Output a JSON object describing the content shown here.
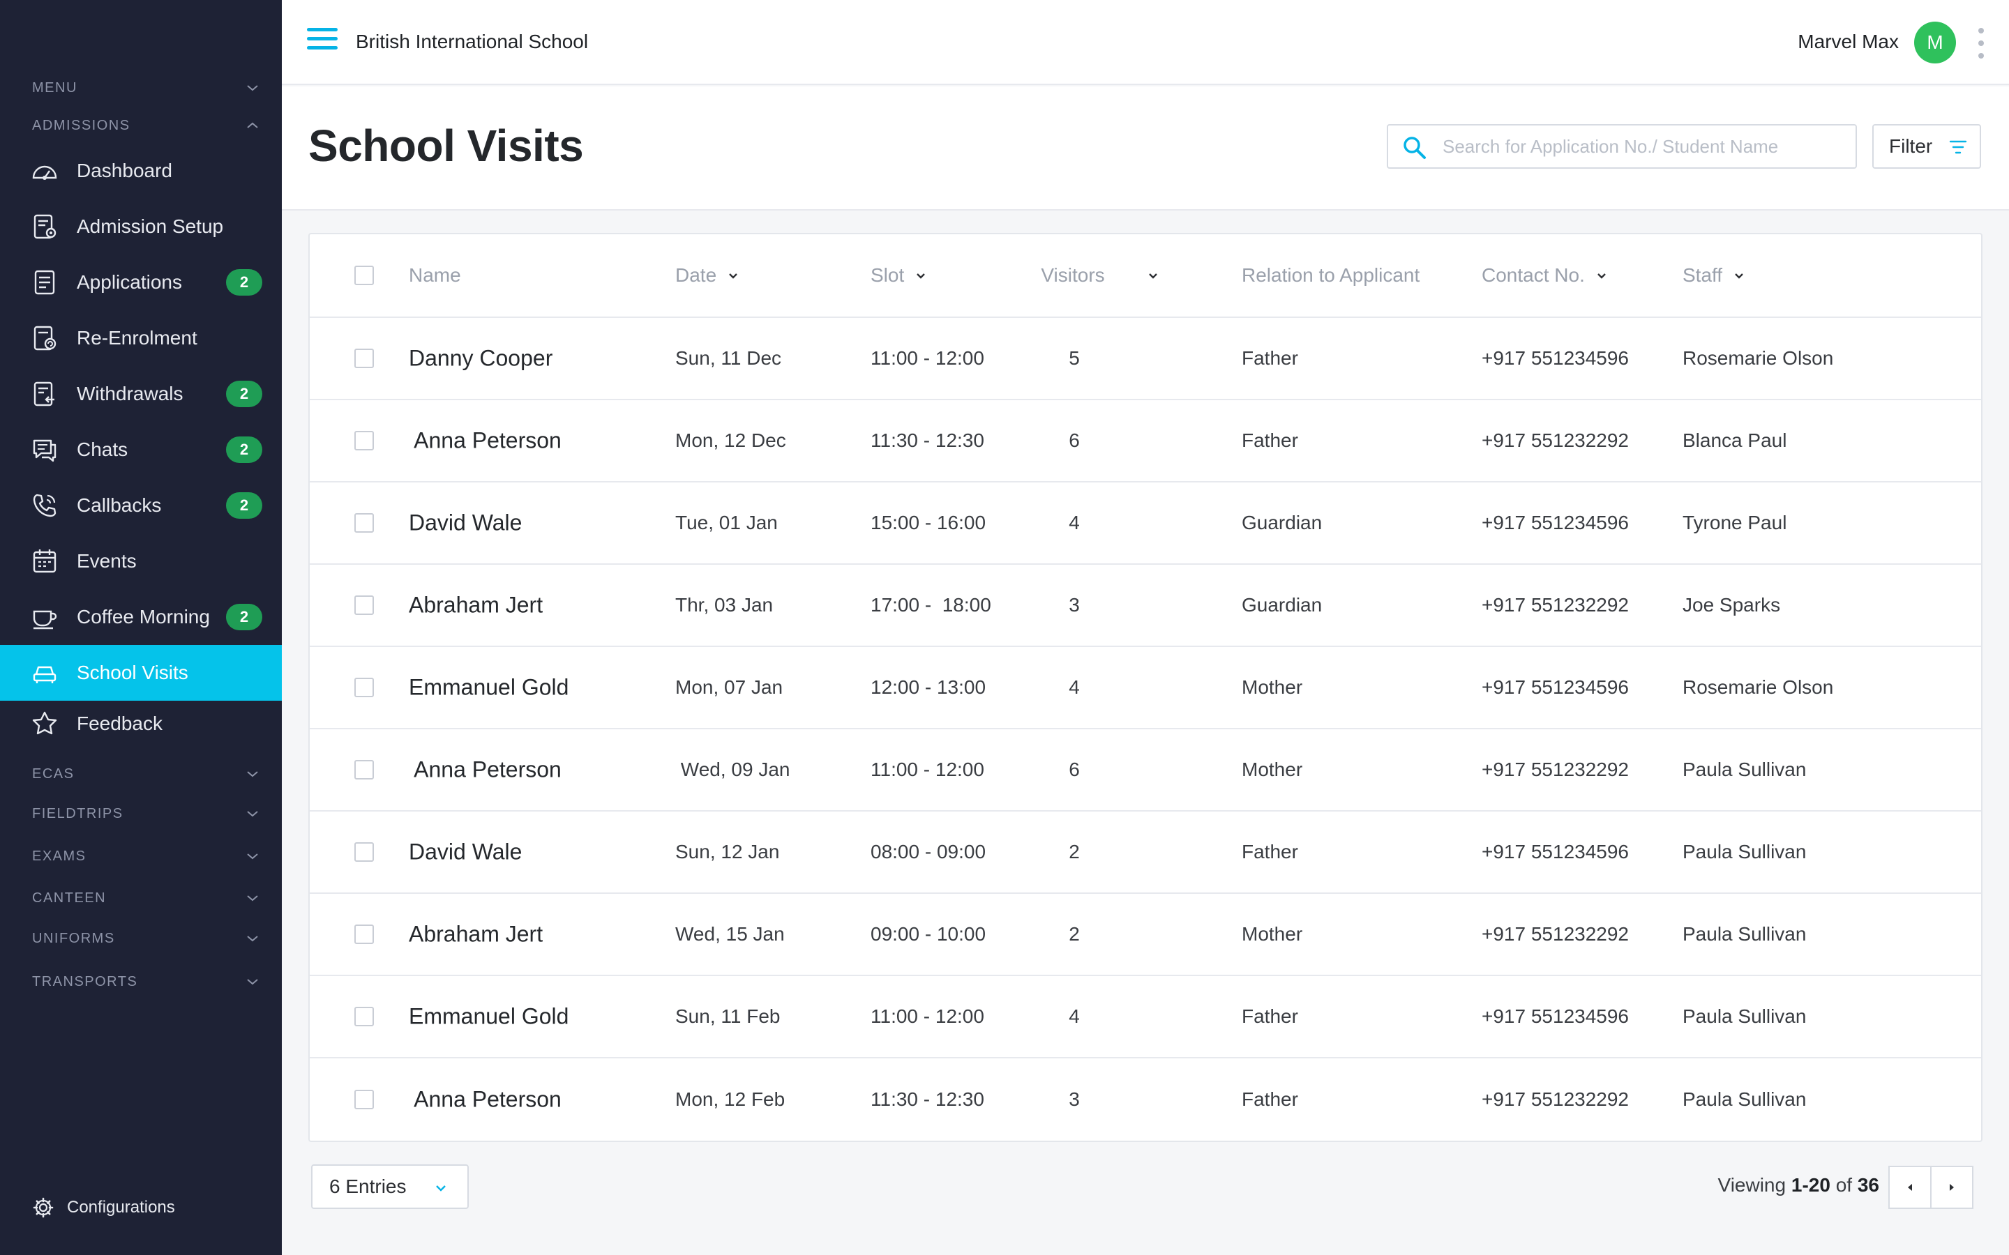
{
  "app": {
    "school_name": "British International School",
    "user_name": "Marvel Max",
    "user_initial": "M"
  },
  "sidebar": {
    "menu_label": "MENU",
    "admissions_label": "ADMISSIONS",
    "items": [
      {
        "label": "Dashboard",
        "icon": "dashboard-icon",
        "badge": null
      },
      {
        "label": "Admission Setup",
        "icon": "admission-setup-icon",
        "badge": null
      },
      {
        "label": "Applications",
        "icon": "applications-icon",
        "badge": "2"
      },
      {
        "label": "Re-Enrolment",
        "icon": "re-enrolment-icon",
        "badge": null
      },
      {
        "label": "Withdrawals",
        "icon": "withdrawals-icon",
        "badge": "2"
      },
      {
        "label": "Chats",
        "icon": "chats-icon",
        "badge": "2"
      },
      {
        "label": "Callbacks",
        "icon": "callbacks-icon",
        "badge": "2"
      },
      {
        "label": "Events",
        "icon": "events-icon",
        "badge": null
      },
      {
        "label": "Coffee Morning",
        "icon": "coffee-icon",
        "badge": "2"
      },
      {
        "label": "School Visits",
        "icon": "school-visits-icon",
        "badge": null,
        "active": true
      },
      {
        "label": "Feedback",
        "icon": "feedback-icon",
        "badge": null
      }
    ],
    "sections": [
      "ECAS",
      "FIELDTRIPS",
      "EXAMS",
      "CANTEEN",
      "UNIFORMS",
      "TRANSPORTS"
    ],
    "configurations_label": "Configurations"
  },
  "header": {
    "title": "School Visits",
    "search_placeholder": "Search for Application No./ Student Name",
    "filter_label": "Filter"
  },
  "table": {
    "columns": {
      "name": "Name",
      "date": "Date",
      "slot": "Slot",
      "visitors": "Visitors",
      "relation": "Relation to Applicant",
      "contact": "Contact No.",
      "staff": "Staff"
    },
    "rows": [
      {
        "name": "Danny Cooper",
        "date": "Sun, 11 Dec",
        "slot": "11:00 - 12:00",
        "visitors": "5",
        "relation": "Father",
        "contact": "+917 551234596",
        "staff": "Rosemarie Olson"
      },
      {
        "name": " Anna Peterson",
        "date": "Mon, 12 Dec",
        "slot": "11:30 - 12:30",
        "visitors": "6",
        "relation": "Father",
        "contact": "+917 551232292",
        "staff": "Blanca Paul"
      },
      {
        "name": "David Wale",
        "date": "Tue, 01 Jan",
        "slot": "15:00 - 16:00",
        "visitors": "4",
        "relation": "Guardian",
        "contact": "+917 551234596",
        "staff": "Tyrone Paul"
      },
      {
        "name": "Abraham Jert",
        "date": "Thr, 03 Jan",
        "slot": "17:00 -  18:00",
        "visitors": "3",
        "relation": "Guardian",
        "contact": "+917 551232292",
        "staff": "Joe Sparks"
      },
      {
        "name": "Emmanuel Gold",
        "date": "Mon, 07 Jan",
        "slot": "12:00 - 13:00",
        "visitors": "4",
        "relation": "Mother",
        "contact": "+917 551234596",
        "staff": "Rosemarie Olson"
      },
      {
        "name": " Anna Peterson",
        "date": " Wed, 09 Jan",
        "slot": "11:00 - 12:00",
        "visitors": "6",
        "relation": "Mother",
        "contact": "+917 551232292",
        "staff": "Paula Sullivan"
      },
      {
        "name": "David Wale",
        "date": "Sun, 12 Jan",
        "slot": "08:00 - 09:00",
        "visitors": "2",
        "relation": "Father",
        "contact": "+917 551234596",
        "staff": "Paula Sullivan"
      },
      {
        "name": "Abraham Jert",
        "date": "Wed, 15 Jan",
        "slot": "09:00 - 10:00",
        "visitors": "2",
        "relation": "Mother",
        "contact": "+917 551232292",
        "staff": "Paula Sullivan"
      },
      {
        "name": "Emmanuel Gold",
        "date": "Sun, 11 Feb",
        "slot": "11:00 - 12:00",
        "visitors": "4",
        "relation": "Father",
        "contact": "+917 551234596",
        "staff": "Paula Sullivan"
      },
      {
        "name": " Anna Peterson",
        "date": "Mon, 12 Feb",
        "slot": "11:30 - 12:30",
        "visitors": "3",
        "relation": "Father",
        "contact": "+917 551232292",
        "staff": "Paula Sullivan"
      }
    ]
  },
  "footer": {
    "entries_label": "6 Entries",
    "viewing_prefix": "Viewing",
    "viewing_range": "1-20",
    "viewing_of": "of",
    "viewing_total": "36"
  },
  "colors": {
    "sidebar_bg": "#1e2235",
    "accent": "#05c3ea",
    "badge": "#1f9d55",
    "avatar": "#2fc15c"
  }
}
